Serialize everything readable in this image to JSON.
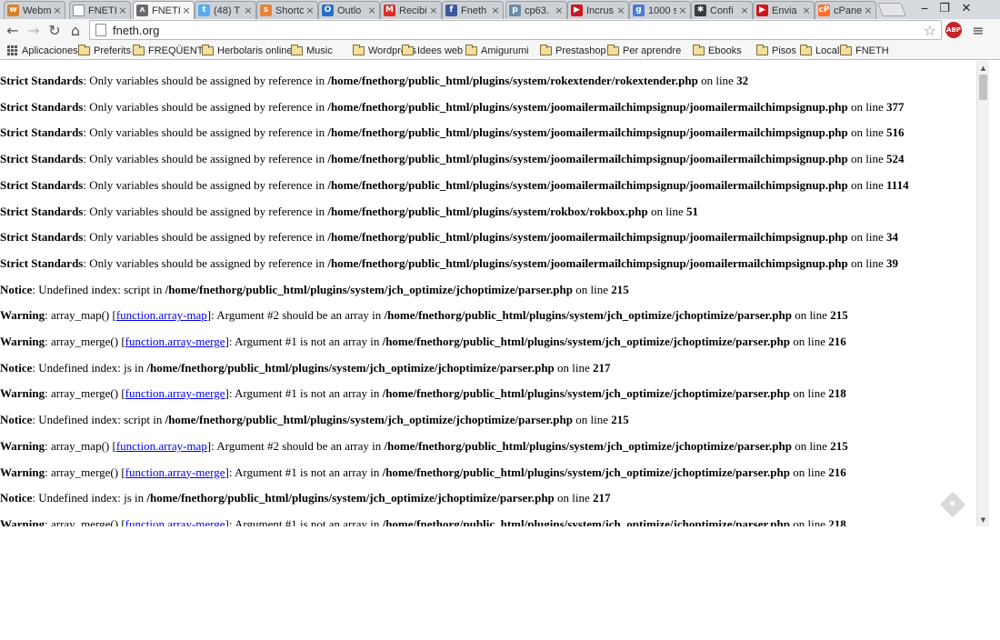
{
  "tabs": [
    {
      "label": "Webm",
      "icon": "webmail-icon",
      "color": "#d9822b",
      "glyph": "w"
    },
    {
      "label": "FNETI",
      "icon": "page-icon",
      "color": "#ffffff",
      "glyph": ""
    },
    {
      "label": "FNETI",
      "icon": "fneth-icon",
      "color": "#6a6a6a",
      "glyph": "ʌ",
      "active": true
    },
    {
      "label": "(48) T",
      "icon": "twitter-icon",
      "color": "#55acee",
      "glyph": "t"
    },
    {
      "label": "Shortc",
      "icon": "shortcode-icon",
      "color": "#e8803a",
      "glyph": "s"
    },
    {
      "label": "Outlo",
      "icon": "outlook-icon",
      "color": "#2a6fc9",
      "glyph": "O"
    },
    {
      "label": "Recibi",
      "icon": "gmail-icon",
      "color": "#d93025",
      "glyph": "M"
    },
    {
      "label": "Fneth",
      "icon": "facebook-icon",
      "color": "#3b5998",
      "glyph": "f"
    },
    {
      "label": "cp63.",
      "icon": "phpmyadmin-icon",
      "color": "#6c8ca8",
      "glyph": "p"
    },
    {
      "label": "Incrus",
      "icon": "youtube-icon",
      "color": "#cc181e",
      "glyph": "▶"
    },
    {
      "label": "1000 s",
      "icon": "google-icon",
      "color": "#4a7ad8",
      "glyph": "g"
    },
    {
      "label": "Confi",
      "icon": "joomla-icon",
      "color": "#3a3a3a",
      "glyph": "✱"
    },
    {
      "label": "Envia",
      "icon": "youtube-icon",
      "color": "#cc181e",
      "glyph": "▶"
    },
    {
      "label": "cPane",
      "icon": "cpanel-icon",
      "color": "#ff6c2c",
      "glyph": "cP"
    }
  ],
  "window_controls": {
    "minimize": "‒",
    "restore": "❐",
    "close": "✕"
  },
  "address_bar": {
    "url": "fneth.org"
  },
  "toolbar_icons": {
    "back": "back-arrow-icon",
    "forward": "forward-arrow-icon",
    "reload": "reload-icon",
    "home": "home-icon",
    "star": "bookmark-star-icon",
    "adblock": "ABP",
    "menu": "menu-icon"
  },
  "bookmarks": [
    {
      "label": "Aplicaciones",
      "icon": "apps-icon"
    },
    {
      "label": "Preferits",
      "icon": "folder-icon"
    },
    {
      "label": "FREQÜENTS",
      "icon": "folder-icon"
    },
    {
      "label": "Herbolaris online",
      "icon": "folder-icon"
    },
    {
      "label": "Music",
      "icon": "folder-icon"
    },
    {
      "label": "Wordpress",
      "icon": "folder-icon"
    },
    {
      "label": "Idees web",
      "icon": "folder-icon"
    },
    {
      "label": "Amigurumi",
      "icon": "folder-icon"
    },
    {
      "label": "Prestashop",
      "icon": "folder-icon"
    },
    {
      "label": "Per aprendre",
      "icon": "folder-icon"
    },
    {
      "label": "Ebooks",
      "icon": "folder-icon"
    },
    {
      "label": "Pisos",
      "icon": "folder-icon"
    },
    {
      "label": "Locals",
      "icon": "folder-icon"
    },
    {
      "label": "FNETH",
      "icon": "folder-icon"
    }
  ],
  "messages": [
    {
      "type": "Strict Standards",
      "pre": ": Only variables should be assigned by reference in ",
      "link": "",
      "post": "",
      "path": "/home/fnethorg/public_html/plugins/system/rokextender/rokextender.php",
      "line": "32"
    },
    {
      "type": "Strict Standards",
      "pre": ": Only variables should be assigned by reference in ",
      "link": "",
      "post": "",
      "path": "/home/fnethorg/public_html/plugins/system/joomailermailchimpsignup/joomailermailchimpsignup.php",
      "line": "377"
    },
    {
      "type": "Strict Standards",
      "pre": ": Only variables should be assigned by reference in ",
      "link": "",
      "post": "",
      "path": "/home/fnethorg/public_html/plugins/system/joomailermailchimpsignup/joomailermailchimpsignup.php",
      "line": "516"
    },
    {
      "type": "Strict Standards",
      "pre": ": Only variables should be assigned by reference in ",
      "link": "",
      "post": "",
      "path": "/home/fnethorg/public_html/plugins/system/joomailermailchimpsignup/joomailermailchimpsignup.php",
      "line": "524"
    },
    {
      "type": "Strict Standards",
      "pre": ": Only variables should be assigned by reference in ",
      "link": "",
      "post": "",
      "path": "/home/fnethorg/public_html/plugins/system/joomailermailchimpsignup/joomailermailchimpsignup.php",
      "line": "1114"
    },
    {
      "type": "Strict Standards",
      "pre": ": Only variables should be assigned by reference in ",
      "link": "",
      "post": "",
      "path": "/home/fnethorg/public_html/plugins/system/rokbox/rokbox.php",
      "line": "51"
    },
    {
      "type": "Strict Standards",
      "pre": ": Only variables should be assigned by reference in ",
      "link": "",
      "post": "",
      "path": "/home/fnethorg/public_html/plugins/system/joomailermailchimpsignup/joomailermailchimpsignup.php",
      "line": "34"
    },
    {
      "type": "Strict Standards",
      "pre": ": Only variables should be assigned by reference in ",
      "link": "",
      "post": "",
      "path": "/home/fnethorg/public_html/plugins/system/joomailermailchimpsignup/joomailermailchimpsignup.php",
      "line": "39"
    },
    {
      "type": "Notice",
      "pre": ": Undefined index: script in ",
      "link": "",
      "post": "",
      "path": "/home/fnethorg/public_html/plugins/system/jch_optimize/jchoptimize/parser.php",
      "line": "215"
    },
    {
      "type": "Warning",
      "pre": ": array_map() [",
      "link": "function.array-map",
      "post": "]: Argument #2 should be an array in ",
      "path": "/home/fnethorg/public_html/plugins/system/jch_optimize/jchoptimize/parser.php",
      "line": "215"
    },
    {
      "type": "Warning",
      "pre": ": array_merge() [",
      "link": "function.array-merge",
      "post": "]: Argument #1 is not an array in ",
      "path": "/home/fnethorg/public_html/plugins/system/jch_optimize/jchoptimize/parser.php",
      "line": "216"
    },
    {
      "type": "Notice",
      "pre": ": Undefined index: js in ",
      "link": "",
      "post": "",
      "path": "/home/fnethorg/public_html/plugins/system/jch_optimize/jchoptimize/parser.php",
      "line": "217"
    },
    {
      "type": "Warning",
      "pre": ": array_merge() [",
      "link": "function.array-merge",
      "post": "]: Argument #1 is not an array in ",
      "path": "/home/fnethorg/public_html/plugins/system/jch_optimize/jchoptimize/parser.php",
      "line": "218"
    },
    {
      "type": "Notice",
      "pre": ": Undefined index: script in ",
      "link": "",
      "post": "",
      "path": "/home/fnethorg/public_html/plugins/system/jch_optimize/jchoptimize/parser.php",
      "line": "215"
    },
    {
      "type": "Warning",
      "pre": ": array_map() [",
      "link": "function.array-map",
      "post": "]: Argument #2 should be an array in ",
      "path": "/home/fnethorg/public_html/plugins/system/jch_optimize/jchoptimize/parser.php",
      "line": "215"
    },
    {
      "type": "Warning",
      "pre": ": array_merge() [",
      "link": "function.array-merge",
      "post": "]: Argument #1 is not an array in ",
      "path": "/home/fnethorg/public_html/plugins/system/jch_optimize/jchoptimize/parser.php",
      "line": "216"
    },
    {
      "type": "Notice",
      "pre": ": Undefined index: js in ",
      "link": "",
      "post": "",
      "path": "/home/fnethorg/public_html/plugins/system/jch_optimize/jchoptimize/parser.php",
      "line": "217"
    },
    {
      "type": "Warning",
      "pre": ": array_merge() [",
      "link": "function.array-merge",
      "post": "]: Argument #1 is not an array in ",
      "path": "/home/fnethorg/public_html/plugins/system/jch_optimize/jchoptimize/parser.php",
      "line": "218"
    }
  ],
  "on_line_text": " on line ",
  "scrollbar": {
    "up": "▲",
    "down": "▼"
  }
}
